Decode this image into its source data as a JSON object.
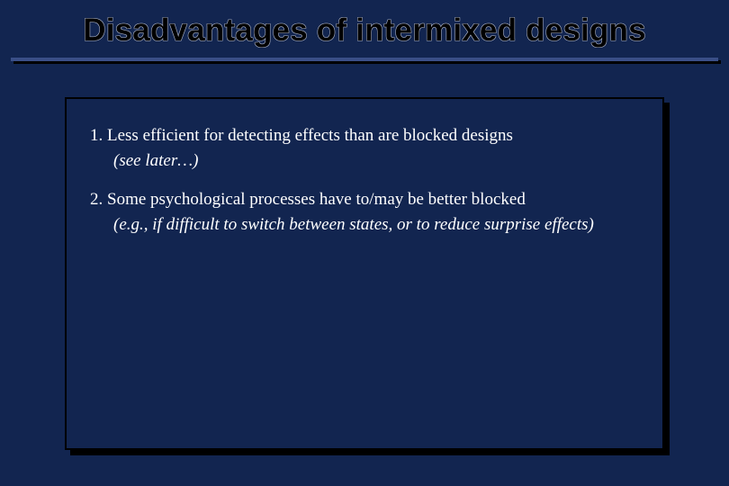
{
  "slide": {
    "title": "Disadvantages of intermixed designs",
    "items": [
      {
        "num": "1.",
        "main": "Less efficient for detecting effects than are blocked designs",
        "sub": "(see later…)"
      },
      {
        "num": "2.",
        "main": "Some psychological processes have to/may be better blocked",
        "sub": "(e.g., if difficult to switch between states, or to reduce surprise effects)"
      }
    ]
  }
}
